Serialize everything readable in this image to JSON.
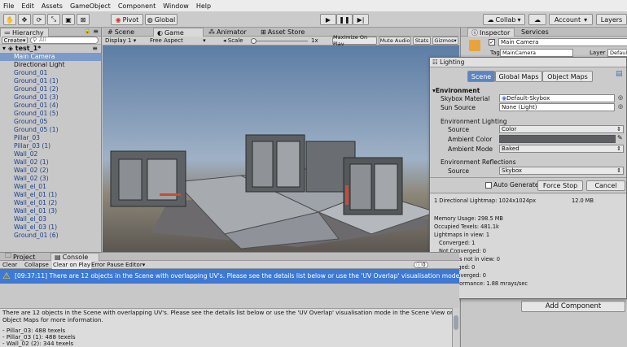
{
  "menu": [
    "File",
    "Edit",
    "Assets",
    "GameObject",
    "Component",
    "Window",
    "Help"
  ],
  "toolbar": {
    "pivot": "Pivot",
    "global": "Global",
    "collab": "Collab",
    "account": "Account",
    "layers": "Layers"
  },
  "hierarchy": {
    "tab": "Hierarchy",
    "create": "Create",
    "search_placeholder": "All",
    "scene": "test_1*",
    "items": [
      "Main Camera",
      "Directional Light",
      "Ground_01",
      "Ground_01 (1)",
      "Ground_01 (2)",
      "Ground_01 (3)",
      "Ground_01 (4)",
      "Ground_01 (5)",
      "Ground_05",
      "Ground_05 (1)",
      "Pillar_03",
      "Pillar_03 (1)",
      "Wall_02",
      "Wall_02 (1)",
      "Wall_02 (2)",
      "Wall_02 (3)",
      "Wall_el_01",
      "Wall_el_01 (1)",
      "Wall_el_01 (2)",
      "Wall_el_01 (3)",
      "Wall_el_03",
      "Wall_el_03 (1)",
      "Ground_01 (6)"
    ]
  },
  "scene_tabs": {
    "scene": "Scene",
    "game": "Game",
    "animator": "Animator",
    "asset_store": "Asset Store"
  },
  "game_bar": {
    "display": "Display 1",
    "aspect": "Free Aspect",
    "scale_label": "Scale",
    "scale_value": "1x",
    "maximize": "Maximize On Play",
    "mute": "Mute Audio",
    "stats": "Stats",
    "gizmos": "Gizmos"
  },
  "inspector": {
    "tab": "Inspector",
    "services": "Services",
    "object_name": "Main Camera",
    "tag_label": "Tag",
    "tag_value": "MainCamera",
    "layer_label": "Layer",
    "layer_value": "Defaul",
    "add_component": "Add Component"
  },
  "lighting": {
    "title": "Lighting",
    "tabs": [
      "Scene",
      "Global Maps",
      "Object Maps"
    ],
    "environment": "Environment",
    "skybox_label": "Skybox Material",
    "skybox_value": "Default-Skybox",
    "sun_label": "Sun Source",
    "sun_value": "None (Light)",
    "env_lighting": "Environment Lighting",
    "source_label": "Source",
    "source_value": "Color",
    "ambient_color_label": "Ambient Color",
    "ambient_mode_label": "Ambient Mode",
    "ambient_mode_value": "Baked",
    "env_reflections": "Environment Reflections",
    "refl_source_label": "Source",
    "refl_source_value": "Skybox",
    "auto_generate": "Auto Generate",
    "force_stop": "Force Stop",
    "cancel": "Cancel",
    "lightmap_info": "1 Directional Lightmap: 1024x1024px",
    "lightmap_size": "12.0 MB",
    "stats": [
      "Memory Usage: 298.5 MB",
      "Occupied Texels: 481.1k",
      "Lightmaps in view: 1",
      "  Converged: 1",
      "  Not Converged: 0",
      "Lightmaps not in view: 0",
      "  Converged: 0",
      "  Not Converged: 0",
      "Bake Performance: 1.88 mrays/sec"
    ]
  },
  "project_tabs": {
    "project": "Project",
    "console": "Console"
  },
  "console_bar": {
    "clear": "Clear",
    "collapse": "Collapse",
    "clear_on_play": "Clear on Play",
    "error_pause": "Error Pause",
    "editor": "Editor",
    "count": "0"
  },
  "console": {
    "message": "[09:37:11] There are 12 objects in the Scene with overlapping UV's. Please see the details list below or use the 'UV Overlap' visualisation mode",
    "detail_1": "There are 12 objects in the Scene with overlapping UV's. Please see the details list below or use the 'UV Overlap' visualisation mode in the Scene View or",
    "detail_2": "Object Maps for more information.",
    "items": [
      "- Pillar_03: 488 texels",
      "- Pillar_03 (1): 488 texels",
      "- Wall_02 (2): 344 texels"
    ]
  }
}
